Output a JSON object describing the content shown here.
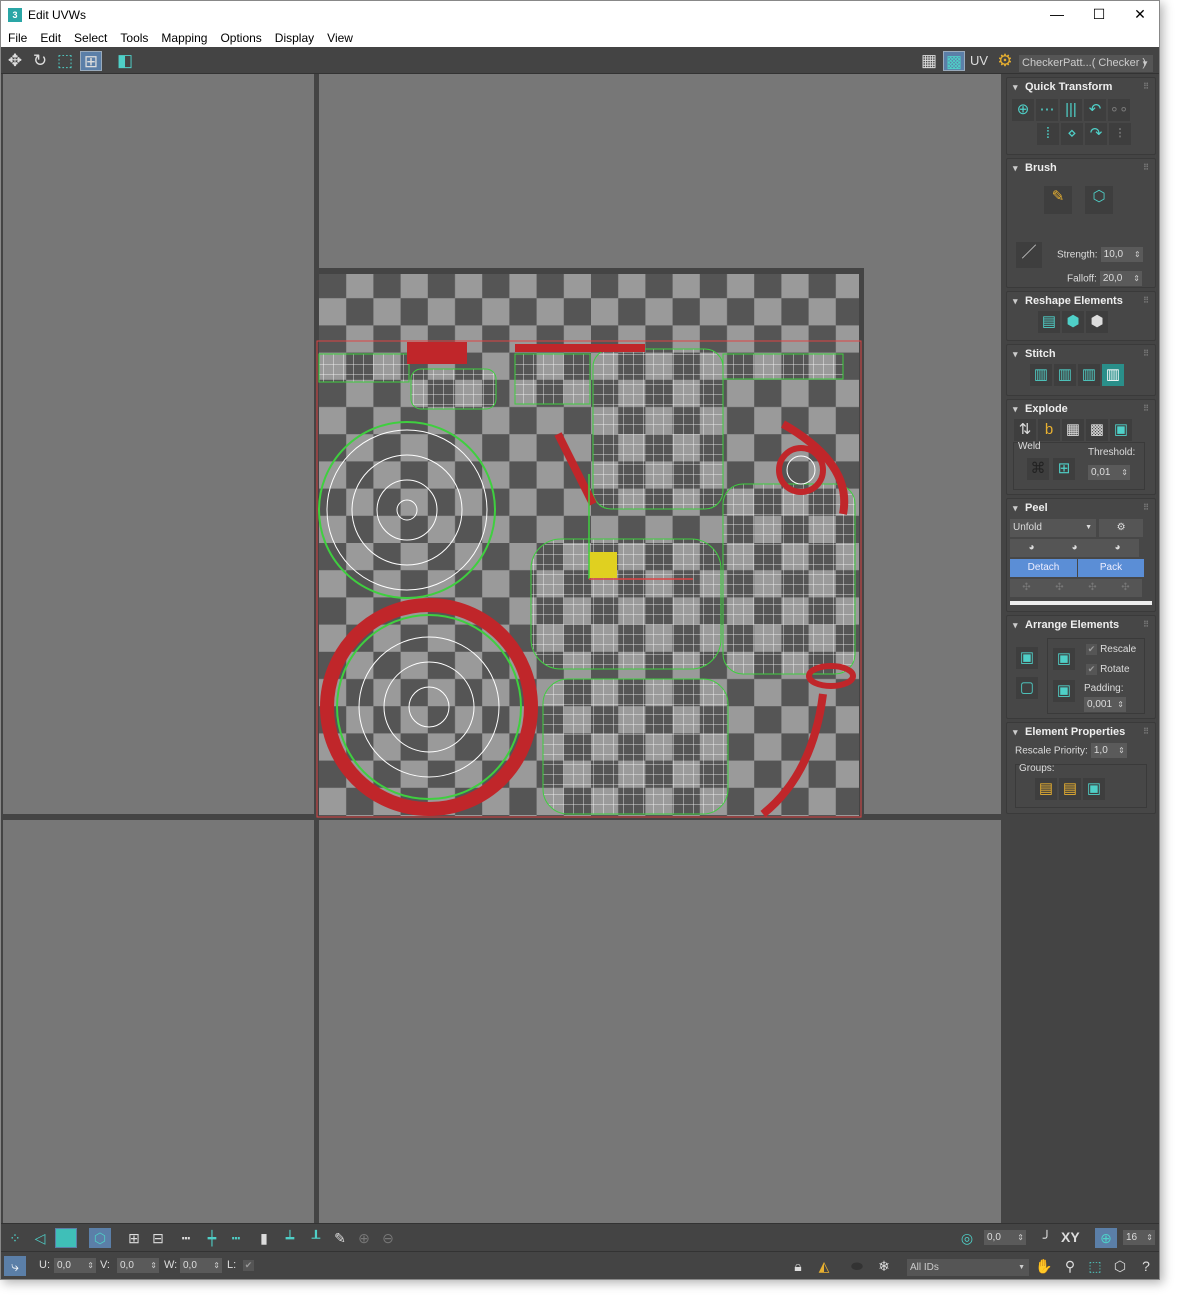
{
  "window": {
    "title": "Edit UVWs",
    "app_icon": "3",
    "controls": {
      "minimize": "—",
      "maximize": "☐",
      "close": "✕"
    }
  },
  "menu": [
    "File",
    "Edit",
    "Select",
    "Tools",
    "Mapping",
    "Options",
    "Display",
    "View"
  ],
  "toolbar": {
    "uv_label": "UV",
    "texture_dropdown": "CheckerPatt...( Checker )"
  },
  "panel": {
    "quick_transform": {
      "title": "Quick Transform"
    },
    "brush": {
      "title": "Brush",
      "strength_label": "Strength:",
      "strength": "10,0",
      "falloff_label": "Falloff:",
      "falloff": "20,0"
    },
    "reshape": {
      "title": "Reshape Elements"
    },
    "stitch": {
      "title": "Stitch"
    },
    "explode": {
      "title": "Explode",
      "weld_label": "Weld",
      "threshold_label": "Threshold:",
      "threshold": "0,01"
    },
    "peel": {
      "title": "Peel",
      "mode": "Unfold",
      "detach": "Detach",
      "pack": "Pack"
    },
    "arrange": {
      "title": "Arrange Elements",
      "rescale": "Rescale",
      "rotate": "Rotate",
      "padding_label": "Padding:",
      "padding": "0,001",
      "rescale_checked": true,
      "rotate_checked": true
    },
    "element_props": {
      "title": "Element Properties",
      "rescale_priority_label": "Rescale Priority:",
      "rescale_priority": "1,0",
      "groups_label": "Groups:"
    }
  },
  "bottom": {
    "u_label": "U:",
    "u": "0,0",
    "v_label": "V:",
    "v": "0,0",
    "w_label": "W:",
    "w": "0,0",
    "l_label": "L:",
    "angle": "0,0",
    "xy_label": "XY",
    "grid": "16",
    "ids": "All IDs"
  },
  "colors": {
    "accent": "#4fd0c8",
    "active_blue": "#5b8ed6",
    "viewport": "#777777",
    "seam_red": "#c0262a",
    "edge_green": "#3fcf3f"
  }
}
